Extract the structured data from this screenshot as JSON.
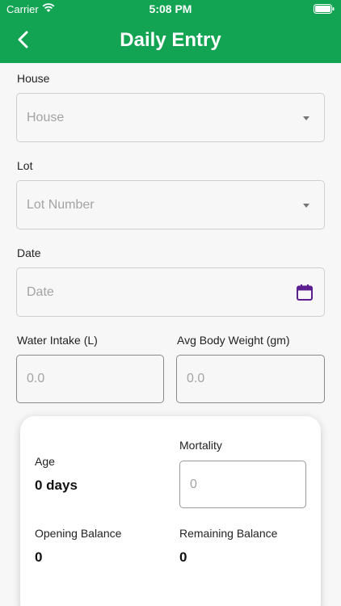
{
  "status_bar": {
    "carrier": "Carrier",
    "time": "5:08 PM"
  },
  "header": {
    "title": "Daily Entry",
    "background_color": "#13a453"
  },
  "form": {
    "house": {
      "label": "House",
      "placeholder": "House"
    },
    "lot": {
      "label": "Lot",
      "placeholder": "Lot Number"
    },
    "date": {
      "label": "Date",
      "placeholder": "Date"
    },
    "water_intake": {
      "label": "Water Intake (L)",
      "placeholder": "0.0"
    },
    "avg_body_weight": {
      "label": "Avg Body Weight (gm)",
      "placeholder": "0.0"
    }
  },
  "summary": {
    "age": {
      "label": "Age",
      "value": "0 days"
    },
    "mortality": {
      "label": "Mortality",
      "placeholder": "0"
    },
    "opening_balance": {
      "label": "Opening Balance",
      "value": "0"
    },
    "remaining_balance": {
      "label": "Remaining Balance",
      "value": "0"
    }
  },
  "colors": {
    "calendar_icon": "#5b1f8f"
  }
}
